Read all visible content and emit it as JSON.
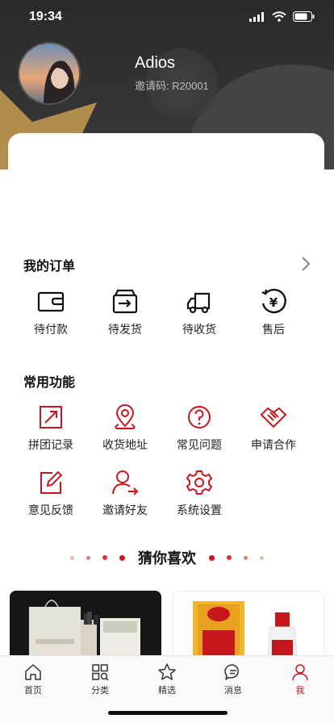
{
  "status_bar": {
    "time": "19:34"
  },
  "profile": {
    "name": "Adios",
    "invite_label": "邀请码:",
    "invite_code": "R20001"
  },
  "orders": {
    "title": "我的订单",
    "items": [
      {
        "label": "待付款",
        "icon": "wallet-icon"
      },
      {
        "label": "待发货",
        "icon": "box-arrow-icon"
      },
      {
        "label": "待收货",
        "icon": "truck-icon"
      },
      {
        "label": "售后",
        "icon": "yen-refund-icon"
      }
    ]
  },
  "functions": {
    "title": "常用功能",
    "items": [
      {
        "label": "拼团记录",
        "icon": "group-record-icon"
      },
      {
        "label": "收货地址",
        "icon": "location-icon"
      },
      {
        "label": "常见问题",
        "icon": "question-icon"
      },
      {
        "label": "申请合作",
        "icon": "handshake-icon"
      },
      {
        "label": "意见反馈",
        "icon": "feedback-icon"
      },
      {
        "label": "邀请好友",
        "icon": "invite-friend-icon"
      },
      {
        "label": "系统设置",
        "icon": "settings-icon"
      }
    ]
  },
  "recommend": {
    "title": "猜你喜欢"
  },
  "tabbar": {
    "items": [
      {
        "label": "首页",
        "icon": "home-icon"
      },
      {
        "label": "分类",
        "icon": "category-icon"
      },
      {
        "label": "精选",
        "icon": "star-icon"
      },
      {
        "label": "消息",
        "icon": "message-icon"
      },
      {
        "label": "我",
        "icon": "user-icon"
      }
    ],
    "active": "我"
  },
  "colors": {
    "accent": "#c8161d",
    "header_bg": "#2f2f2f",
    "gold": "#b8924d"
  }
}
